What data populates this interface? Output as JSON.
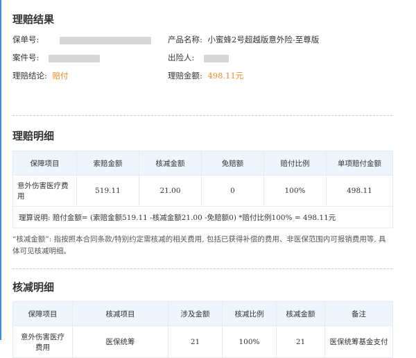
{
  "result": {
    "title": "理赔结果",
    "policy_no_label": "保单号:",
    "product_name_label": "产品名称:",
    "product_name_value": "小蜜蜂2号超越版意外险-至尊版",
    "case_no_label": "案件号:",
    "insured_label": "出险人:",
    "conclusion_label": "理赔结论:",
    "conclusion_value": "赔付",
    "amount_label": "理赔金额:",
    "amount_value": "498.11元"
  },
  "details": {
    "title": "理赔明细",
    "headers": [
      "保障项目",
      "索赔金额",
      "核减金额",
      "免赔额",
      "赔付比例",
      "单项赔付金额"
    ],
    "row": [
      "意外伤害医疗费用",
      "519.11",
      "21.00",
      "0",
      "100%",
      "498.11"
    ],
    "calc_note": "理算说明: 赔付金额= (索赔金额519.11 -核减金额21.00 -免赔额0) *赔付比例100% = 498.11元",
    "footnote": "“核减金额”: 指按照本合同条款/特别约定需核减的相关费用, 包括已获得补偿的费用、非医保范围内可报销费用等, 具体可见核减明细。"
  },
  "deduction": {
    "title": "核减明细",
    "headers": [
      "保障项目",
      "核减项目",
      "涉及金额",
      "核减比例",
      "核减金额",
      "备注"
    ],
    "row": [
      "意外伤害医疗费用",
      "医保统筹",
      "21",
      "100%",
      "21",
      "医保统筹基金支付"
    ]
  },
  "colors": {
    "accent_orange": "#f08a24",
    "header_bg": "#eef5fd",
    "left_rule": "#3e8ed9"
  }
}
